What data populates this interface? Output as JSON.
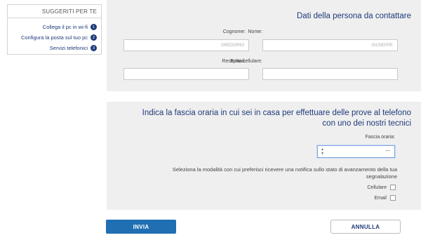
{
  "sidebar": {
    "title": "SUGGERITI PER TE",
    "items": [
      {
        "number": "1",
        "label": "Collega il pc in wi-fi"
      },
      {
        "number": "2",
        "label": "Configura la posta sul tuo pc"
      },
      {
        "number": "3",
        "label": "Servizi telefonici"
      }
    ]
  },
  "contact": {
    "title": "Dati della persona da contattare",
    "name_label": "Nome:",
    "name_value": "GIUSEPPE",
    "surname_label": "Cognome:",
    "surname_value": "GREGORIO",
    "phone_label": "Recapito cellulare:",
    "phone_value": "",
    "email_label": "E-mail:",
    "email_value": ""
  },
  "hours": {
    "title_line1": "Indica la fascia oraria in cui sei in casa per effettuare delle prove al telefono",
    "title_line2": "con uno dei nostri tecnici",
    "slot_label": "Fascia oraria:",
    "slot_value": "---",
    "notify_line1": "Seleziona la modalità con cui preferisci ricevere una notifica sullo stato di avanzamento della tua",
    "notify_line2": "segnalazione",
    "option_mobile": "Cellulare",
    "option_email": "Email"
  },
  "buttons": {
    "send": "INVIA",
    "cancel": "ANNULLA"
  },
  "colors": {
    "accent": "#1e3a7a",
    "button_blue": "#1f6fb2",
    "panel_bg": "#efefef"
  }
}
